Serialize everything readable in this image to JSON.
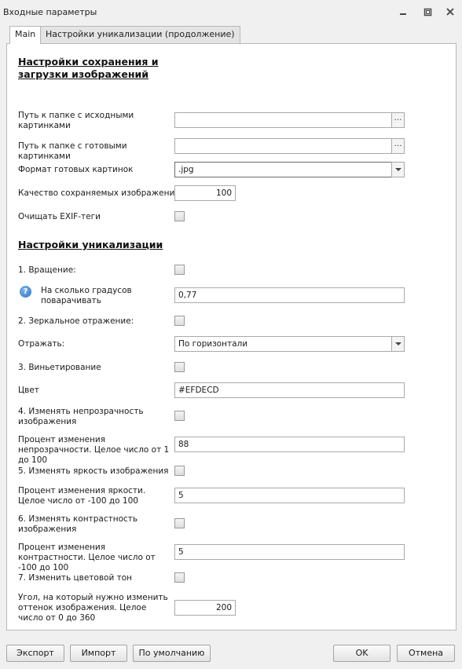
{
  "window": {
    "title": "Входные параметры"
  },
  "tabs": [
    {
      "label": "Main"
    },
    {
      "label": "Настройки уникализации (продолжение)"
    }
  ],
  "sections": {
    "save": "Настройки сохранения и загрузки изображений",
    "unique": "Настройки уникализации"
  },
  "fields": {
    "source_folder": {
      "label": "Путь к папке с исходными картинками",
      "value": ""
    },
    "result_folder": {
      "label": "Путь к папке с готовыми картинками",
      "value": ""
    },
    "format": {
      "label": "Формат готовых картинок",
      "value": ".jpg"
    },
    "quality": {
      "label": "Качество сохраняемых изображений",
      "value": "100"
    },
    "exif": {
      "label": "Очищать EXIF-теги",
      "checked": false
    },
    "rotation": {
      "label": "1. Вращение:",
      "checked": false
    },
    "rotation_degrees": {
      "label": "На сколько градусов поварачивать",
      "value": "0,77"
    },
    "mirror": {
      "label": "2. Зеркальное отражение:",
      "checked": false
    },
    "reflect": {
      "label": "Отражать:",
      "value": "По горизонтали"
    },
    "vignette": {
      "label": "3. Виньетирование",
      "checked": false
    },
    "color": {
      "label": "Цвет",
      "value": "#EFDECD"
    },
    "opacity": {
      "label": "4. Изменять непрозрачность изображения",
      "checked": false
    },
    "opacity_percent": {
      "label": "Процент изменения непрозрачности. Целое число от 1 до 100",
      "value": "88"
    },
    "brightness": {
      "label": "5. Изменять яркость изображения",
      "checked": false
    },
    "brightness_percent": {
      "label": "Процент изменения яркости. Целое число от -100 до 100",
      "value": "5"
    },
    "contrast": {
      "label": "6. Изменять контрастность изображения",
      "checked": false
    },
    "contrast_percent": {
      "label": "Процент изменения контрастности. Целое число от -100 до 100",
      "value": "5"
    },
    "hue": {
      "label": "7. Изменить цветовой тон",
      "checked": false
    },
    "hue_angle": {
      "label": "Угол, на который нужно изменить оттенок изображения. Целое число от 0 до 360",
      "value": "200"
    }
  },
  "buttons": {
    "export": "Экспорт",
    "import": "Импорт",
    "defaults": "По умолчанию",
    "ok": "OK",
    "cancel": "Отмена"
  },
  "icons": {
    "browse": "…",
    "help": "?"
  }
}
